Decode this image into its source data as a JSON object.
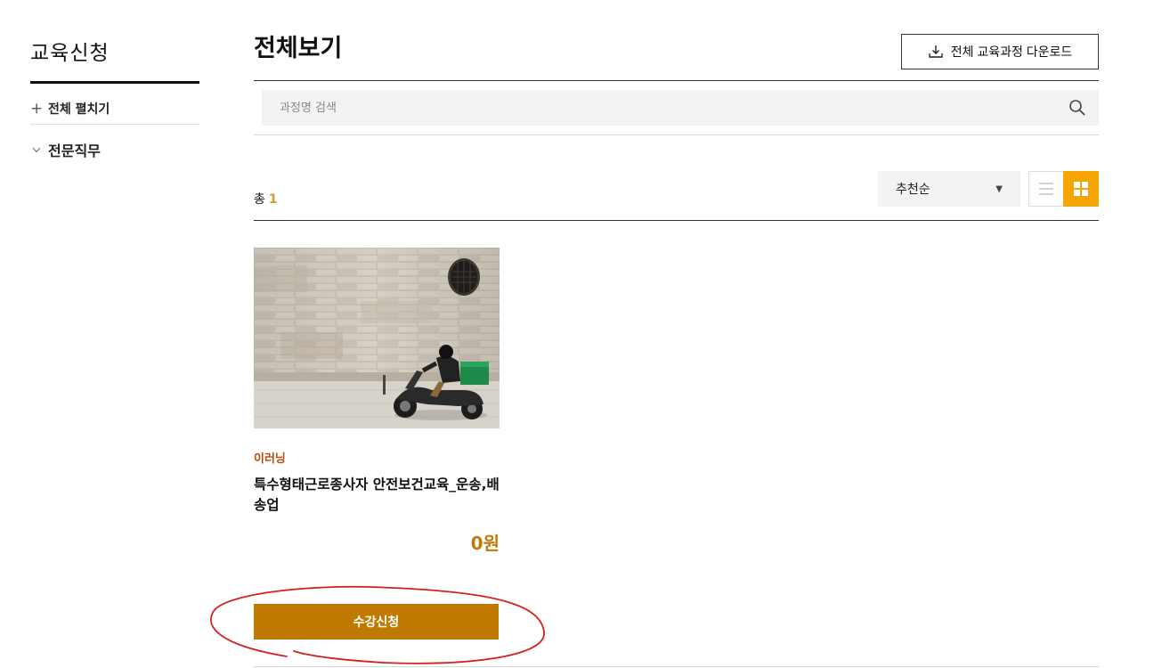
{
  "sidebar": {
    "title": "교육신청",
    "expand_all": {
      "icon": "plus-icon",
      "label": "전체 펼치기"
    },
    "categories": [
      {
        "icon": "chevron-down-icon",
        "label": "전문직무"
      }
    ]
  },
  "header": {
    "title": "전체보기",
    "download_button": {
      "icon": "download-icon",
      "label": "전체 교육과정 다운로드"
    }
  },
  "search": {
    "placeholder": "과정명 검색",
    "value": "",
    "icon": "search-icon"
  },
  "list_toolbar": {
    "total_label": "총",
    "total_count": "1",
    "sort": {
      "selected": "추천순",
      "icon": "caret-down-icon"
    },
    "views": [
      {
        "name": "list",
        "icon": "list-view-icon",
        "active": false
      },
      {
        "name": "grid",
        "icon": "grid-view-icon",
        "active": true
      }
    ]
  },
  "courses": [
    {
      "type": "이러닝",
      "title": "특수형태근로종사자 안전보건교육_운송,배송업",
      "price": "0원",
      "enroll_label": "수강신청",
      "thumbnail": "scooter-delivery-photo"
    }
  ],
  "colors": {
    "accent": "#f6a602",
    "enroll_button": "#c07a00",
    "price": "#c07a0a",
    "course_type": "#b34a0c",
    "annotation_circle": "#d61f1f"
  }
}
